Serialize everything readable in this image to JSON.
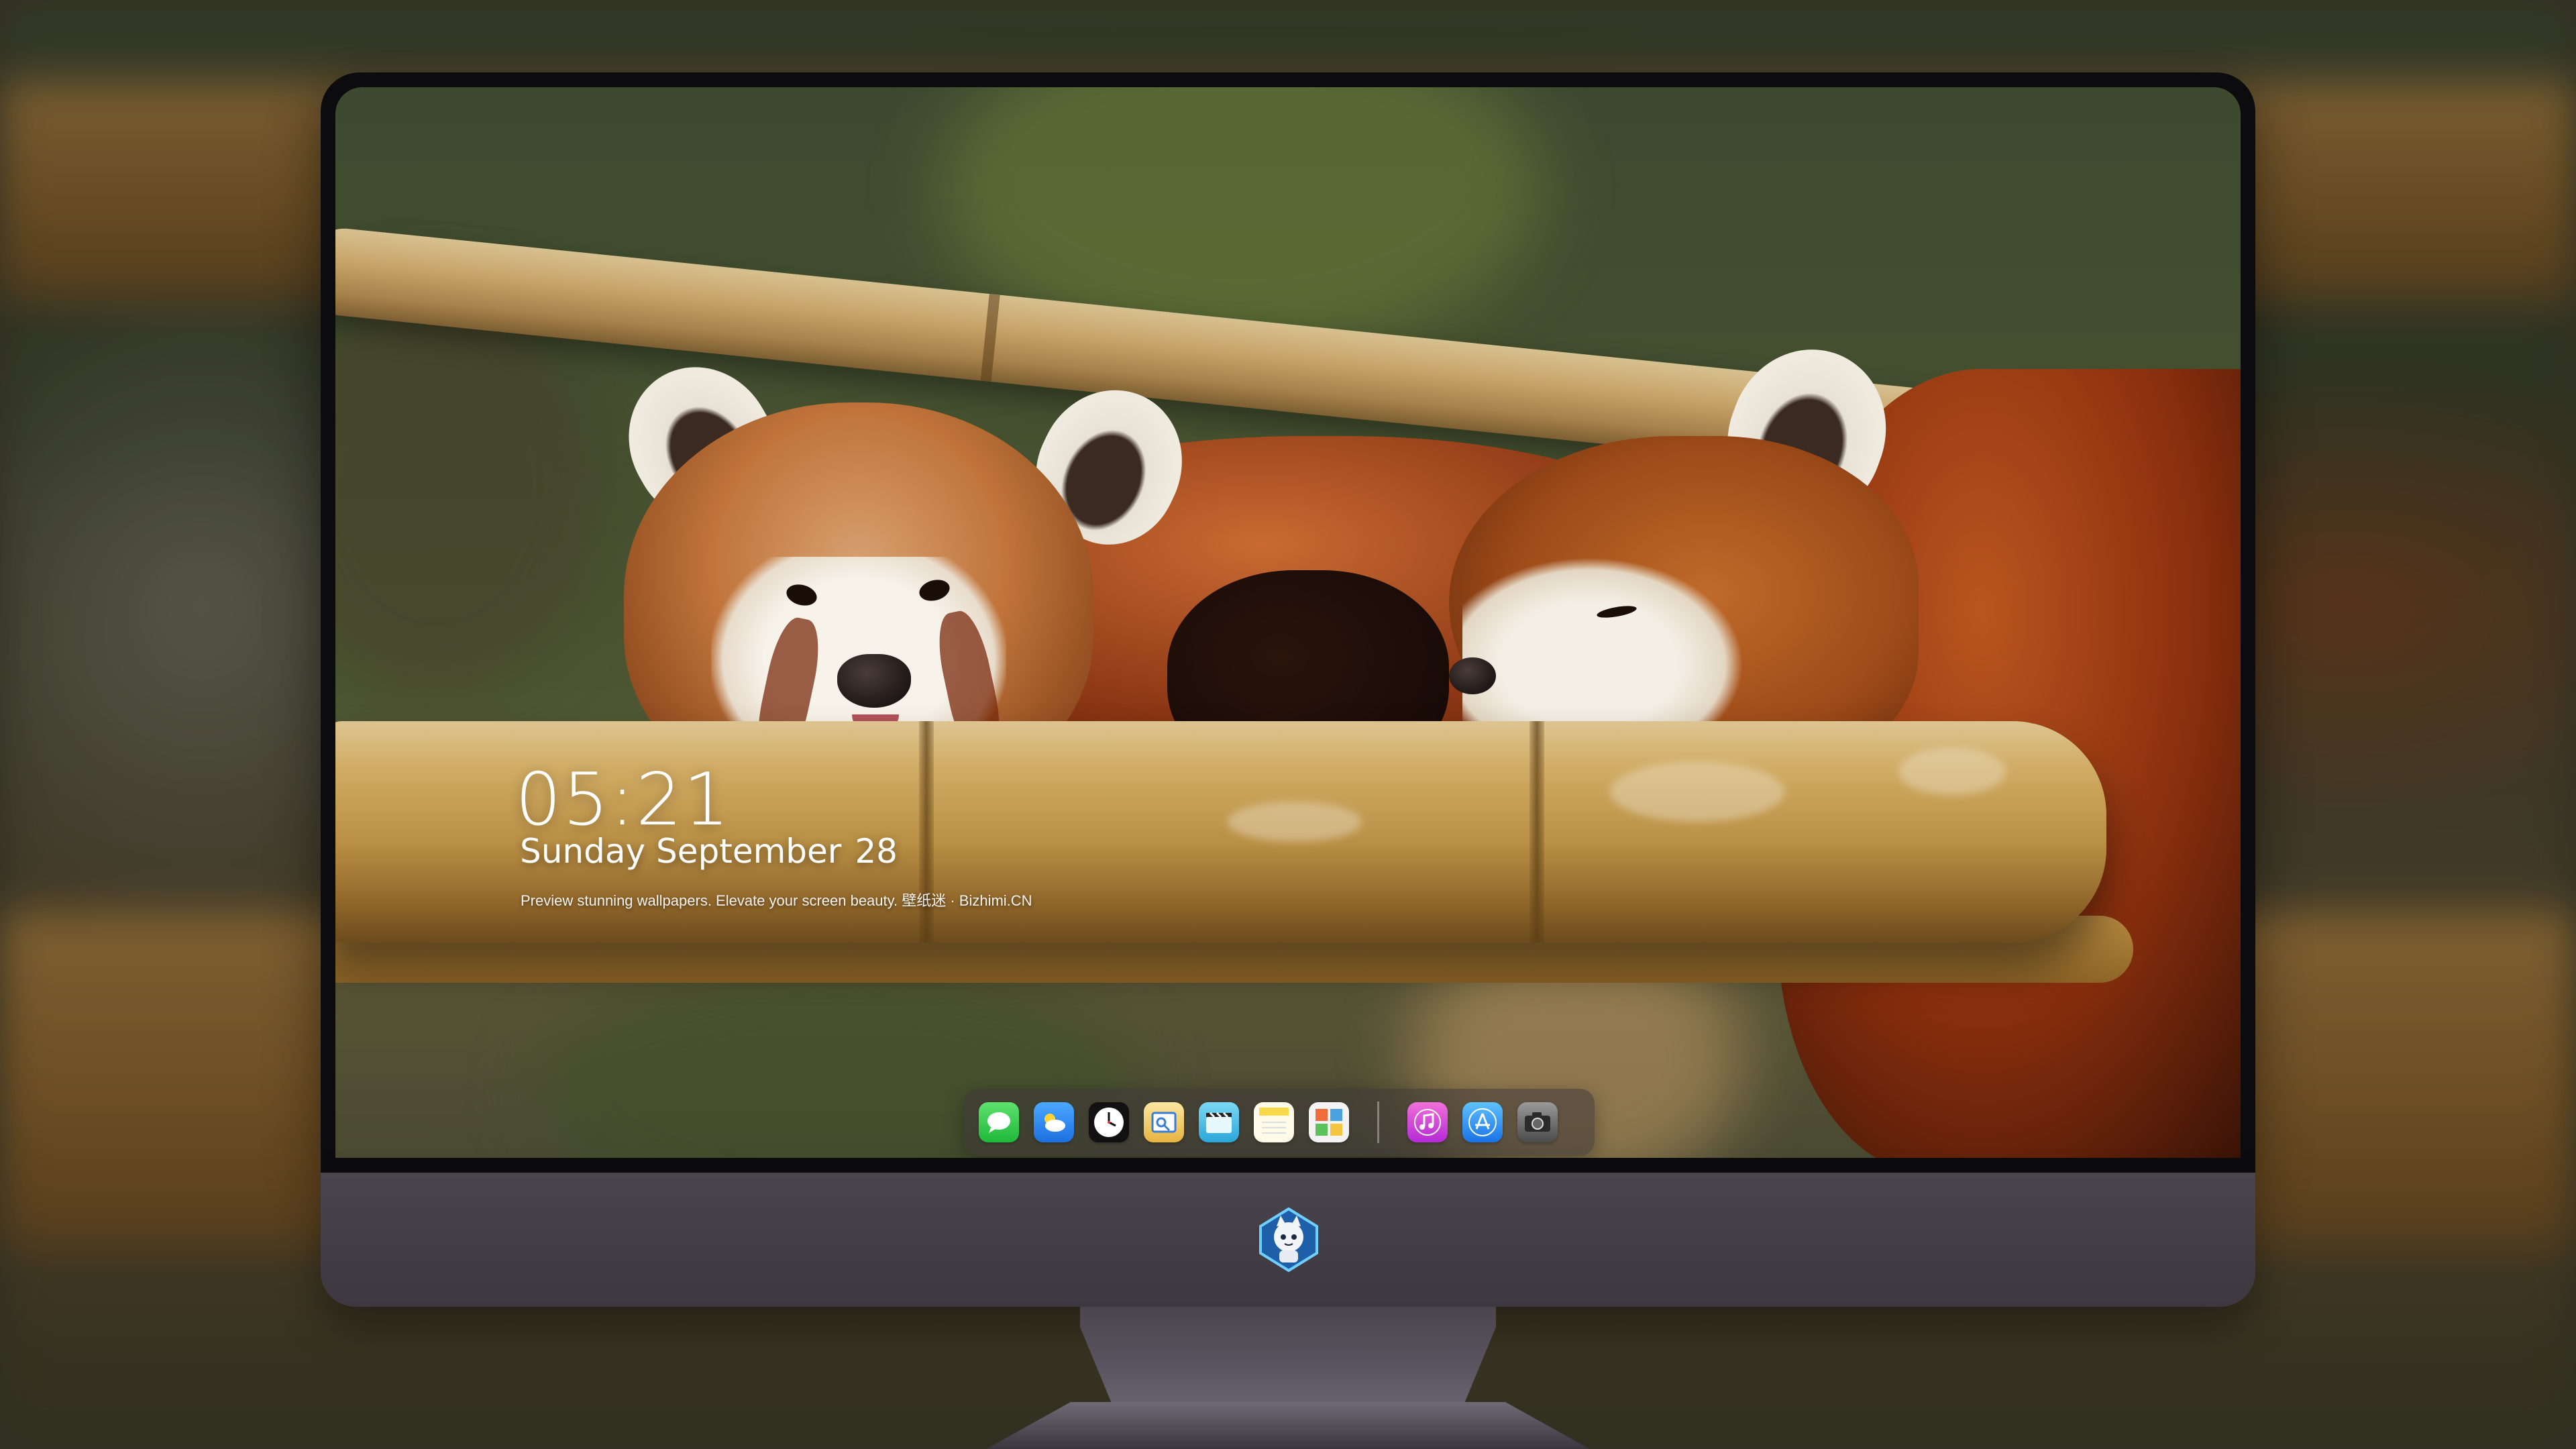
{
  "lock_screen": {
    "time": "05:21",
    "weekday_month": "Sunday September",
    "day": "28",
    "tagline": "Preview stunning wallpapers. Elevate your screen beauty. 壁纸迷 · Bizhimi.CN"
  },
  "dock": {
    "apps": [
      {
        "name": "messages-icon",
        "color": "#33c748"
      },
      {
        "name": "weather-icon",
        "color": "#2f8cf0"
      },
      {
        "name": "clock-icon",
        "color": "#ffffff"
      },
      {
        "name": "preview-icon",
        "color": "#f5c542"
      },
      {
        "name": "video-icon",
        "color": "#38b8e8"
      },
      {
        "name": "notes-icon",
        "color": "#f9d94a"
      },
      {
        "name": "photos-icon",
        "color": "#4aa3df"
      },
      {
        "name": "music-icon",
        "color": "#d84ad8"
      },
      {
        "name": "app-store-icon",
        "color": "#1e88f0"
      },
      {
        "name": "camera-icon",
        "color": "#5a5a5a"
      }
    ]
  }
}
